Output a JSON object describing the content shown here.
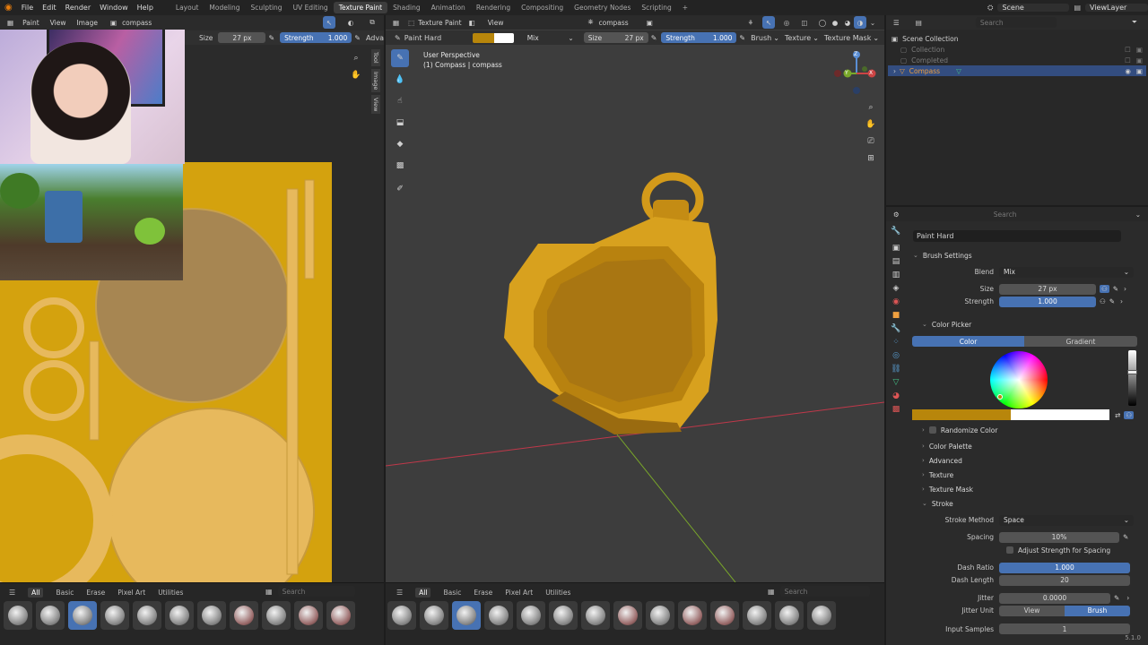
{
  "topbar": {
    "menus": [
      "File",
      "Edit",
      "Render",
      "Window",
      "Help"
    ],
    "workspaces": [
      "Layout",
      "Modeling",
      "Sculpting",
      "UV Editing",
      "Texture Paint",
      "Shading",
      "Animation",
      "Rendering",
      "Compositing",
      "Geometry Nodes",
      "Scripting"
    ],
    "active_workspace": "Texture Paint",
    "add": "+",
    "scene": "Scene",
    "view_layer": "ViewLayer"
  },
  "image_editor": {
    "header": {
      "mode": "Paint",
      "view": "View",
      "image": "Image",
      "image_name": "compass"
    },
    "tool": {
      "size_label": "Size",
      "size_value": "27 px",
      "strength_label": "Strength",
      "strength_value": "1.000",
      "more": "Adva"
    },
    "side_tabs": [
      "Tool",
      "Image",
      "View"
    ],
    "brush_tabs": [
      "All",
      "Basic",
      "Erase",
      "Pixel Art",
      "Utilities"
    ],
    "search_placeholder": "Search"
  },
  "viewport": {
    "header": {
      "mode": "Texture Paint",
      "view": "View",
      "object": "compass"
    },
    "tool": {
      "brush": "Paint Hard",
      "blend": "Mix",
      "size_label": "Size",
      "size_value": "27 px",
      "strength_label": "Strength",
      "strength_value": "1.000",
      "brush_menu": "Brush",
      "texture_menu": "Texture",
      "texture_mask_menu": "Texture Mask"
    },
    "info_line1": "User Perspective",
    "info_line2": "(1) Compass | compass",
    "gizmo": {
      "x": "X",
      "y": "Y",
      "z": "Z"
    },
    "brush_tabs": [
      "All",
      "Basic",
      "Erase",
      "Pixel Art",
      "Utilities"
    ],
    "search_placeholder": "Search",
    "colors": {
      "primary": "#B8860B",
      "secondary": "#FFFFFF",
      "axis_x": "#c0384a",
      "axis_y": "#7aa82a"
    }
  },
  "outliner": {
    "search_placeholder": "Search",
    "root": "Scene Collection",
    "items": [
      {
        "label": "Collection",
        "disabled": true
      },
      {
        "label": "Completed",
        "disabled": true
      },
      {
        "label": "Compass",
        "selected": true
      }
    ]
  },
  "properties": {
    "search_placeholder": "Search",
    "brush_name": "Paint Hard",
    "brush_settings": "Brush Settings",
    "blend_label": "Blend",
    "blend_value": "Mix",
    "size_label": "Size",
    "size_value": "27 px",
    "strength_label": "Strength",
    "strength_value": "1.000",
    "color_picker": "Color Picker",
    "color_tab": "Color",
    "gradient_tab": "Gradient",
    "randomize_color": "Randomize Color",
    "sections": [
      "Color Palette",
      "Advanced",
      "Texture",
      "Texture Mask"
    ],
    "stroke": "Stroke",
    "stroke_method_label": "Stroke Method",
    "stroke_method_value": "Space",
    "spacing_label": "Spacing",
    "spacing_value": "10%",
    "adjust_strength": "Adjust Strength for Spacing",
    "dash_ratio_label": "Dash Ratio",
    "dash_ratio_value": "1.000",
    "dash_length_label": "Dash Length",
    "dash_length_value": "20",
    "jitter_label": "Jitter",
    "jitter_value": "0.0000",
    "jitter_unit_label": "Jitter Unit",
    "jitter_unit_view": "View",
    "jitter_unit_brush": "Brush",
    "input_samples_label": "Input Samples",
    "input_samples_value": "1"
  },
  "status": {
    "version": "5.1.0"
  }
}
